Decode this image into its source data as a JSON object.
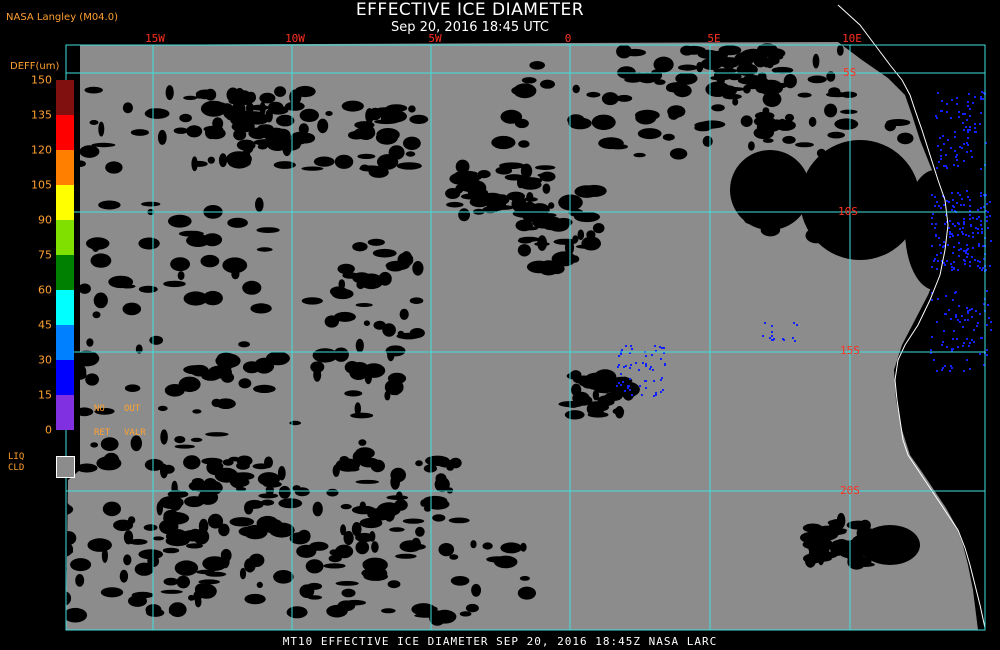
{
  "header": {
    "title": "EFFECTIVE ICE DIAMETER",
    "subtitle": "Sep 20, 2016 18:45 UTC",
    "source": "NASA Langley (M04.0)"
  },
  "grid": {
    "lon_labels": [
      "15W",
      "10W",
      "5W",
      "0",
      "5E",
      "10E"
    ],
    "lat_labels": [
      "5S",
      "10S",
      "15S",
      "20S"
    ]
  },
  "legend": {
    "unit_label": "DEFF(um)",
    "ticks": [
      "150",
      "135",
      "120",
      "105",
      "90",
      "75",
      "60",
      "45",
      "30",
      "15",
      "0"
    ],
    "colors": [
      "#801010",
      "#ff0000",
      "#ff7f00",
      "#ffff00",
      "#80e000",
      "#008000",
      "#00ffff",
      "#0080ff",
      "#0000ff",
      "#8030e0"
    ],
    "no_ret": [
      "NO",
      "RET"
    ],
    "out_valr": [
      "OUT",
      "VALR"
    ],
    "liq_cld": [
      "LIQ",
      "CLD"
    ],
    "liq_color": "#8c8c8c"
  },
  "footer": {
    "text": "MT10  EFFECTIVE ICE DIAMETER  SEP 20, 2016 18:45Z  NASA LARC"
  },
  "colors": {
    "grid": "#40e0e0",
    "cloud": "#8c8c8c",
    "clear": "#000000",
    "coastline": "#ffffff",
    "ice": "#1020ff"
  }
}
